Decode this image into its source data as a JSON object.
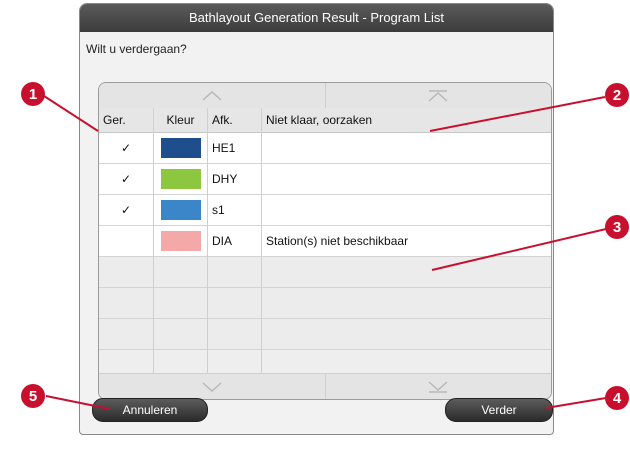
{
  "window": {
    "title": "Bathlayout Generation Result - Program List"
  },
  "prompt": "Wilt u verdergaan?",
  "table": {
    "headers": {
      "done": "Ger.",
      "color": "Kleur",
      "abbr": "Afk.",
      "reason": "Niet klaar, oorzaken"
    },
    "rows": [
      {
        "done": "✓",
        "color": "#1f4e8c",
        "abbr": "HE1",
        "reason": ""
      },
      {
        "done": "✓",
        "color": "#8dc63f",
        "abbr": "DHY",
        "reason": ""
      },
      {
        "done": "✓",
        "color": "#3a86c8",
        "abbr": "s1",
        "reason": ""
      },
      {
        "done": "",
        "color": "#f4a9a8",
        "abbr": "DIA",
        "reason": "Station(s) niet beschikbaar"
      }
    ]
  },
  "buttons": {
    "cancel": "Annuleren",
    "continue": "Verder"
  },
  "callouts": [
    "1",
    "2",
    "3",
    "4",
    "5"
  ],
  "colors": {
    "callout": "#c8102e"
  }
}
